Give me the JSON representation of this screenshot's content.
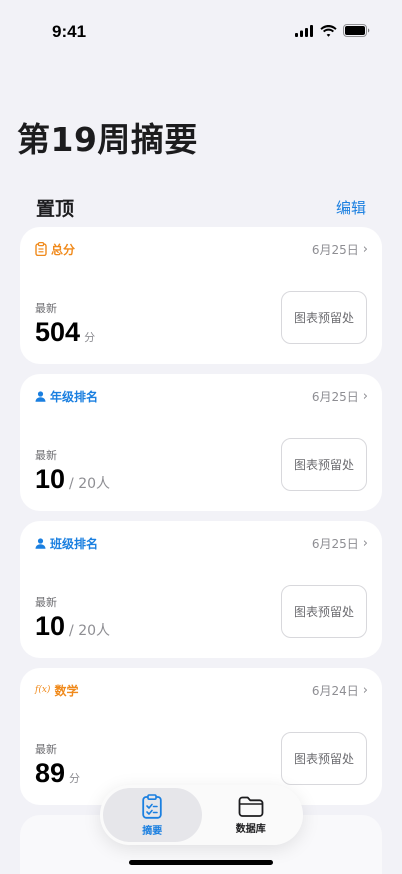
{
  "status": {
    "time": "9:41"
  },
  "page": {
    "title": "第19周摘要"
  },
  "section": {
    "title": "置顶",
    "edit": "编辑"
  },
  "cards": [
    {
      "label": "总分",
      "icon": "clipboard-icon",
      "color": "#f08a1c",
      "date": "6月25日",
      "latest": "最新",
      "value": "504",
      "unit": "分",
      "placeholder": "图表预留处"
    },
    {
      "label": "年级排名",
      "icon": "person-icon",
      "color": "#1a7fe0",
      "date": "6月25日",
      "latest": "最新",
      "value": "10",
      "unit": "/ 20人",
      "placeholder": "图表预留处"
    },
    {
      "label": "班级排名",
      "icon": "person-icon",
      "color": "#1a7fe0",
      "date": "6月25日",
      "latest": "最新",
      "value": "10",
      "unit": "/ 20人",
      "placeholder": "图表预留处"
    },
    {
      "label": "数学",
      "icon": "function-icon",
      "color": "#f08a1c",
      "date": "6月24日",
      "latest": "最新",
      "value": "89",
      "unit": "分",
      "placeholder": "图表预留处"
    }
  ],
  "tabs": [
    {
      "label": "摘要",
      "icon": "summary-icon",
      "active": true
    },
    {
      "label": "数据库",
      "icon": "folder-icon",
      "active": false
    }
  ]
}
